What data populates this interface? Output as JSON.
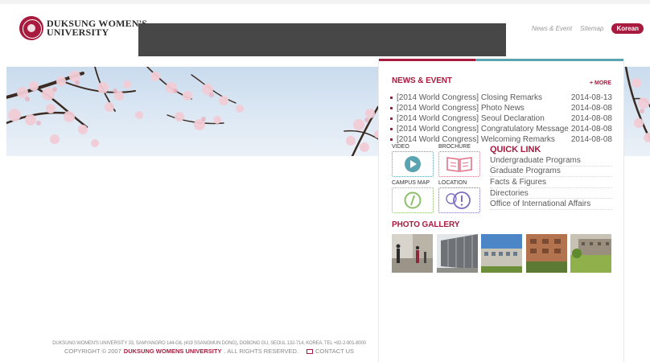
{
  "header": {
    "logo_line1": "DUKSUNG WOMEN'S",
    "logo_line2": "UNIVERSITY",
    "links": [
      "News & Event",
      "Sitemap"
    ],
    "lang_button": "Korean"
  },
  "news": {
    "title": "NEWS & EVENT",
    "more_label": "+ MORE",
    "items": [
      {
        "title": "[2014 World Congress] Closing Remarks",
        "date": "2014-08-13"
      },
      {
        "title": "[2014 World Congress] Photo News",
        "date": "2014-08-08"
      },
      {
        "title": "[2014 World Congress] Seoul Declaration",
        "date": "2014-08-08"
      },
      {
        "title": "[2014 World Congress] Congratulatory Message",
        "date": "2014-08-08"
      },
      {
        "title": "[2014 World Congress] Welcoming Remarks",
        "date": "2014-08-08"
      }
    ]
  },
  "quick_icons": [
    {
      "label": "VIDEO",
      "icon": "play-icon",
      "color": "#5aa3b0"
    },
    {
      "label": "BROCHURE",
      "icon": "book-icon",
      "color": "#e1748a"
    },
    {
      "label": "CAMPUS MAP",
      "icon": "compass-icon",
      "color": "#8cbf6a"
    },
    {
      "label": "LOCATION",
      "icon": "location-bubble-icon",
      "color": "#7b6fc2"
    }
  ],
  "quick_link": {
    "title": "QUICK LINK",
    "items": [
      "Undergraduate Programs",
      "Graduate Programs",
      "Facts & Figures",
      "Directories",
      "Office of International Affairs"
    ]
  },
  "photo_gallery": {
    "title": "PHOTO GALLERY"
  },
  "footer": {
    "address": "DUKSUNG WOMEN'S UNIVERSITY 33, SAMYANGRO 144-GIL (419 SSANGMUN DONG), DOBONG GU, SEOUL 132-714, KOREA. TEL +82-2-901-8000",
    "copyright_prefix": "COPYRIGHT © 2007",
    "copyright_brand": "DUKSUNG WOMENS UNIVERSITY",
    "copyright_suffix": ". ALL RIGHTS RESERVED.",
    "contact": "CONTACT US"
  },
  "colors": {
    "brand": "#a81b3e",
    "nav_bar": "#474747",
    "accent_teal": "#5aa3b0"
  }
}
